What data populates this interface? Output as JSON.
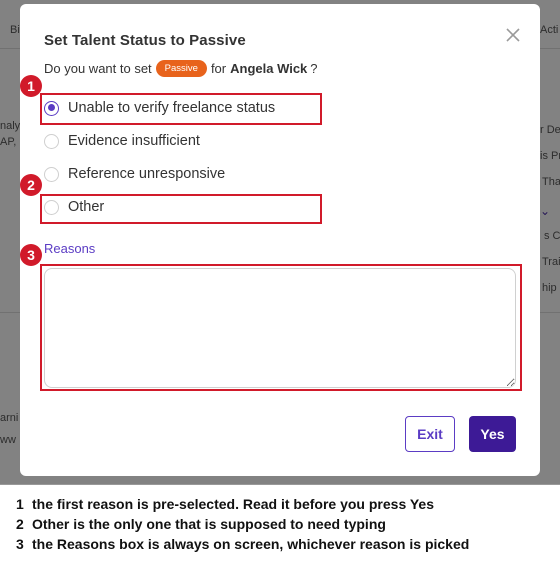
{
  "background": {
    "fragments": [
      "Bi",
      "Acti",
      "naly",
      "AP,",
      "r De",
      "is Pr",
      "Tha",
      "s Co",
      "Trai",
      "hip",
      "arni",
      "ww"
    ]
  },
  "modal": {
    "title": "Set Talent Status to Passive",
    "question_prefix": "Do you want to set",
    "status_badge": "Passive",
    "question_for": "for",
    "talent_name": "Angela Wick",
    "question_suffix": "?",
    "options": [
      {
        "label": "Unable to verify freelance status",
        "selected": true
      },
      {
        "label": "Evidence insufficient",
        "selected": false
      },
      {
        "label": "Reference unresponsive",
        "selected": false
      },
      {
        "label": "Other",
        "selected": false
      }
    ],
    "reasons_label": "Reasons",
    "reasons_value": "",
    "exit_label": "Exit",
    "yes_label": "Yes"
  },
  "annotations": {
    "markers": [
      "1",
      "2",
      "3"
    ],
    "notes": [
      {
        "num": "1",
        "text": "the first reason is pre-selected. Read it before you press Yes"
      },
      {
        "num": "2",
        "text": "Other is the only one that is supposed to need typing"
      },
      {
        "num": "3",
        "text": "the Reasons box is always on screen, whichever reason is picked"
      }
    ]
  },
  "colors": {
    "accent": "#5b3cc4",
    "primary_button": "#3d1a96",
    "status_badge": "#e8631c",
    "annotation_red": "#d11a2a",
    "overlay": "rgba(0,0,0,0.48)"
  },
  "icons": {
    "close": "close-icon",
    "resize": "resize-handle-icon",
    "chevron": "chevron-down-icon"
  }
}
